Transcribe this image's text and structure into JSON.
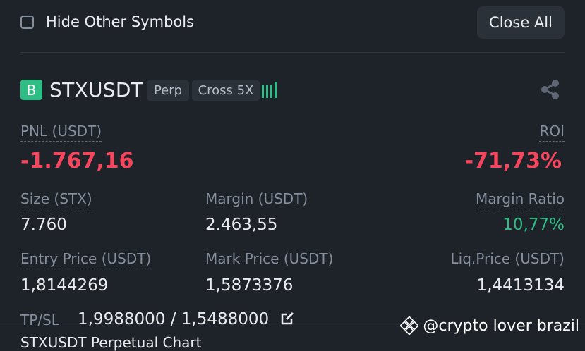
{
  "header": {
    "hide_other_symbols": "Hide Other Symbols",
    "close_all": "Close All"
  },
  "position": {
    "exchange_badge": "B",
    "symbol": "STXUSDT",
    "contract_type": "Perp",
    "margin_mode": "Cross 5X",
    "pnl_label": "PNL (USDT)",
    "pnl_value": "-1.767,16",
    "roi_label": "ROI",
    "roi_value": "-71,73%",
    "size_label": "Size (STX)",
    "size_value": "7.760",
    "margin_label": "Margin (USDT)",
    "margin_value": "2.463,55",
    "margin_ratio_label": "Margin Ratio",
    "margin_ratio_value": "10,77%",
    "entry_price_label": "Entry Price (USDT)",
    "entry_price_value": "1,8144269",
    "mark_price_label": "Mark Price (USDT)",
    "mark_price_value": "1,5873376",
    "liq_price_label": "Liq.Price (USDT)",
    "liq_price_value": "1,4413134",
    "tpsl_label": "TP/SL",
    "tpsl_value": "1,9988000 / 1,5488000"
  },
  "footer": {
    "next_item_partial": "STXUSDT Perpetual Chart",
    "watermark": "@crypto lover brazil"
  },
  "colors": {
    "background": "#1e2329",
    "negative": "#f6465d",
    "positive": "#2ebd85",
    "muted": "#848e9c"
  }
}
